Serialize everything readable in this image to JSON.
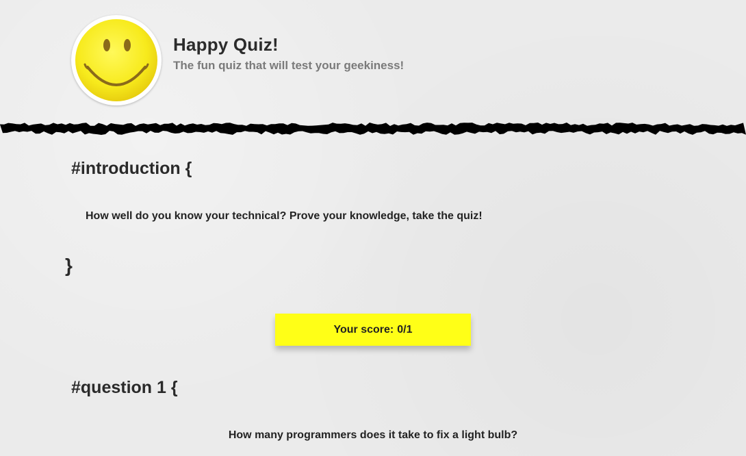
{
  "header": {
    "title": "Happy Quiz!",
    "subtitle": "The fun quiz that will test your geekiness!",
    "logo_icon": "smiley-face-icon"
  },
  "introduction": {
    "heading": "#introduction {",
    "text": "How well do you know your technical? Prove your knowledge, take the quiz!",
    "closing": "}"
  },
  "score": {
    "label": "Your score:",
    "value": "0/1"
  },
  "question1": {
    "heading": "#question 1 {",
    "text": "How many programmers does it take to fix a light bulb?"
  },
  "colors": {
    "background": "#ebebeb",
    "score_box": "#ffff17",
    "smiley_yellow": "#f7ea1c",
    "divider": "#000000"
  }
}
